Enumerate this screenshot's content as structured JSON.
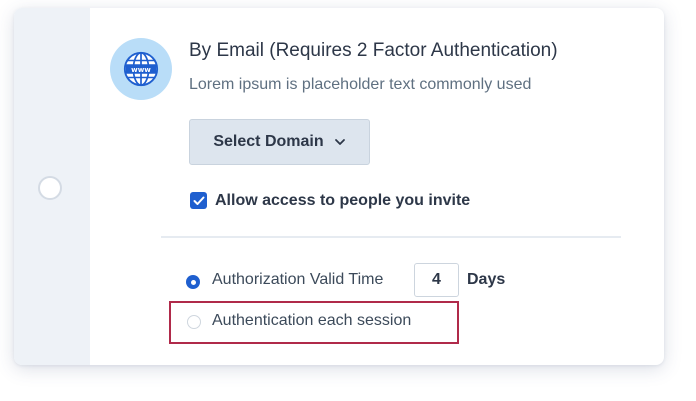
{
  "option": {
    "title": "By Email (Requires 2 Factor Authentication)",
    "description": "Lorem ipsum is placeholder text commonly used",
    "icon": "globe-www-icon"
  },
  "select_domain": {
    "label": "Select Domain",
    "icon": "chevron-down-icon"
  },
  "allow_access": {
    "label": "Allow access to people you invite",
    "checked": true
  },
  "auth_options": {
    "valid_time": {
      "label": "Authorization Valid Time",
      "value": "4",
      "unit": "Days",
      "selected": true
    },
    "each_session": {
      "label": "Authentication each session",
      "selected": false
    }
  },
  "colors": {
    "accent": "#1f5fcf",
    "highlight_border": "#b02a4a",
    "icon_bg": "#b9ddf8"
  }
}
